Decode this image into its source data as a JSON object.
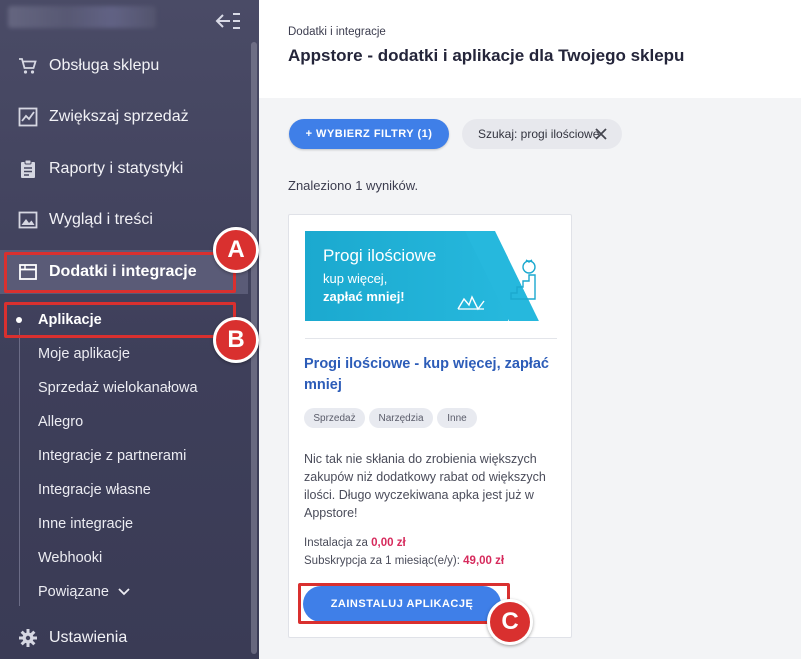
{
  "sidebar": {
    "items": [
      {
        "label": "Obsługa sklepu",
        "icon": "cart-icon"
      },
      {
        "label": "Zwiększaj sprzedaż",
        "icon": "chart-icon"
      },
      {
        "label": "Raporty i statystyki",
        "icon": "clipboard-icon"
      },
      {
        "label": "Wygląd i treści",
        "icon": "image-icon"
      },
      {
        "label": "Dodatki i integracje",
        "icon": "window-icon"
      },
      {
        "label": "Ustawienia",
        "icon": "gear-icon"
      }
    ],
    "subitems": [
      "Aplikacje",
      "Moje aplikacje",
      "Sprzedaż wielokanałowa",
      "Allegro",
      "Integracje z partnerami",
      "Integracje własne",
      "Inne integracje",
      "Webhooki",
      "Powiązane"
    ]
  },
  "header": {
    "breadcrumb": "Dodatki i integracje",
    "title": "Appstore - dodatki i aplikacje dla Twojego sklepu"
  },
  "filters": {
    "button_label": "+ WYBIERZ FILTRY (1)",
    "search_chip": "Szukaj: progi ilościowe"
  },
  "results_text": "Znaleziono 1 wyników.",
  "card": {
    "banner": {
      "line1": "Progi ilościowe",
      "line2": "kup więcej,",
      "line3": "zapłać mniej!"
    },
    "title": "Progi ilościowe - kup więcej, zapłać mniej",
    "tags": [
      "Sprzedaż",
      "Narzędzia",
      "Inne"
    ],
    "description": "Nic tak nie skłania do zrobienia większych zakupów niż dodatkowy rabat od większych ilości. Długo wyczekiwana apka jest już w Appstore!",
    "install_label": "Instalacja za",
    "install_price": "0,00 zł",
    "subscription_label": "Subskrypcja za 1 miesiąc(e/y):",
    "subscription_price": "49,00 zł",
    "install_button": "ZAINSTALUJ APLIKACJĘ"
  },
  "annotations": [
    "A",
    "B",
    "C"
  ],
  "colors": {
    "sidebar": "#3e3f5a",
    "accent": "#3f7fe8",
    "highlight": "#d9302f",
    "price": "#d62a5c",
    "banner": "#1ba9cf"
  }
}
